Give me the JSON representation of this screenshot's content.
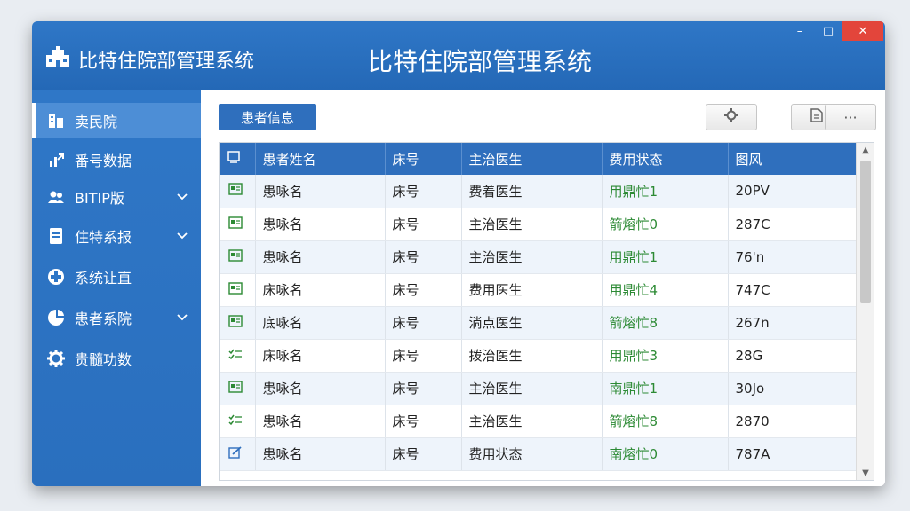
{
  "app": {
    "name": "比特住院部管理系统",
    "window_title": "比特住院部管理系统",
    "controls": {
      "minimize": "–",
      "maximize": "□",
      "close": "✕"
    }
  },
  "colors": {
    "primary": "#2f6fbd",
    "sidebar": "#2f77c7",
    "fee_text": "#2c8a34",
    "close": "#e3453b"
  },
  "sidebar": {
    "items": [
      {
        "label": "卖民院",
        "icon": "building-icon",
        "active": true,
        "chevron": false
      },
      {
        "label": "番号数据",
        "icon": "chart-arrow-icon",
        "active": false,
        "chevron": false
      },
      {
        "label": "BITIP版",
        "icon": "users-icon",
        "active": false,
        "chevron": true
      },
      {
        "label": "住特系报",
        "icon": "document-icon",
        "active": false,
        "chevron": true
      },
      {
        "label": "系统让直",
        "icon": "medical-cross-icon",
        "active": false,
        "chevron": false
      },
      {
        "label": "患者系院",
        "icon": "pie-chart-icon",
        "active": false,
        "chevron": true
      },
      {
        "label": "贵髓功数",
        "icon": "gear-icon",
        "active": false,
        "chevron": false
      }
    ]
  },
  "toolbar": {
    "tab_label": "患者信息",
    "settings_icon": "gear-icon",
    "document_icon": "document-icon",
    "more_label": "···"
  },
  "table": {
    "columns": [
      "",
      "患者姓名",
      "床号",
      "主治医生",
      "费用状态",
      "图风"
    ],
    "rows": [
      {
        "icon": "id-card-icon",
        "name": "患咏名",
        "bed": "床号",
        "doctor": "费着医生",
        "fee": "用鼎忙1",
        "extra": "20PV"
      },
      {
        "icon": "id-card-icon",
        "name": "患咏名",
        "bed": "床号",
        "doctor": "主治医生",
        "fee": "箭熔忙0",
        "extra": "287C"
      },
      {
        "icon": "id-card-icon",
        "name": "患咏名",
        "bed": "床号",
        "doctor": "主治医生",
        "fee": "用鼎忙1",
        "extra": "76'n"
      },
      {
        "icon": "id-card-icon",
        "name": "床咏名",
        "bed": "床号",
        "doctor": "费用医生",
        "fee": "用鼎忙4",
        "extra": "747C"
      },
      {
        "icon": "id-card-icon",
        "name": "底咏名",
        "bed": "床号",
        "doctor": "淌点医生",
        "fee": "箭熔忙8",
        "extra": "267n"
      },
      {
        "icon": "check-list-icon",
        "name": "床咏名",
        "bed": "床号",
        "doctor": "拨治医生",
        "fee": "用鼎忙3",
        "extra": "28G"
      },
      {
        "icon": "id-card-icon",
        "name": "患咏名",
        "bed": "床号",
        "doctor": "主治医生",
        "fee": "南鼎忙1",
        "extra": "30Jo"
      },
      {
        "icon": "check-list-icon",
        "name": "患咏名",
        "bed": "床号",
        "doctor": "主治医生",
        "fee": "箭熔忙8",
        "extra": "2870"
      },
      {
        "icon": "edit-icon",
        "name": "患咏名",
        "bed": "床号",
        "doctor": "费用状态",
        "fee": "南熔忙0",
        "extra": "787A"
      }
    ]
  }
}
